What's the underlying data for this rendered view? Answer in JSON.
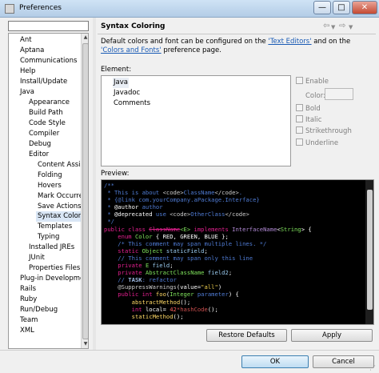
{
  "window": {
    "title": "Preferences",
    "minimize_glyph": "—",
    "maximize_glyph": "□",
    "close_glyph": "✕"
  },
  "filter": {
    "value": "",
    "placeholder": ""
  },
  "tree": {
    "items": [
      {
        "label": "Ant",
        "level": 0
      },
      {
        "label": "Aptana",
        "level": 0
      },
      {
        "label": "Communications",
        "level": 0
      },
      {
        "label": "Help",
        "level": 0
      },
      {
        "label": "Install/Update",
        "level": 0
      },
      {
        "label": "Java",
        "level": 0
      },
      {
        "label": "Appearance",
        "level": 1
      },
      {
        "label": "Build Path",
        "level": 1
      },
      {
        "label": "Code Style",
        "level": 1
      },
      {
        "label": "Compiler",
        "level": 1
      },
      {
        "label": "Debug",
        "level": 1
      },
      {
        "label": "Editor",
        "level": 1
      },
      {
        "label": "Content Assist",
        "level": 2
      },
      {
        "label": "Folding",
        "level": 2
      },
      {
        "label": "Hovers",
        "level": 2
      },
      {
        "label": "Mark Occurrences",
        "level": 2
      },
      {
        "label": "Save Actions",
        "level": 2
      },
      {
        "label": "Syntax Coloring",
        "level": 2,
        "selected": true
      },
      {
        "label": "Templates",
        "level": 2
      },
      {
        "label": "Typing",
        "level": 2
      },
      {
        "label": "Installed JREs",
        "level": 1
      },
      {
        "label": "JUnit",
        "level": 1
      },
      {
        "label": "Properties Files Editor",
        "level": 1
      },
      {
        "label": "Plug-in Development",
        "level": 0
      },
      {
        "label": "Rails",
        "level": 0
      },
      {
        "label": "Ruby",
        "level": 0
      },
      {
        "label": "Run/Debug",
        "level": 0
      },
      {
        "label": "Team",
        "level": 0
      },
      {
        "label": "XML",
        "level": 0
      }
    ]
  },
  "page": {
    "title": "Syntax Coloring",
    "description_before": "Default colors and font can be configured on the ",
    "link_text_editors": "'Text Editors'",
    "description_middle": " and on the ",
    "link_colors_fonts": "'Colors and Fonts'",
    "description_after": " preference page.",
    "element_label": "Element:",
    "elements": [
      "Java",
      "Javadoc",
      "Comments"
    ],
    "selected_element": "Java",
    "options": {
      "enable": "Enable",
      "color": "Color:",
      "bold": "Bold",
      "italic": "Italic",
      "strikethrough": "Strikethrough",
      "underline": "Underline"
    },
    "preview_label": "Preview:"
  },
  "nav": {
    "back": "⇦",
    "back_menu": "▼",
    "forward": "⇨",
    "forward_menu": "▼"
  },
  "preview_code": [
    [
      [
        "/**",
        "com"
      ]
    ],
    [
      [
        " * This is about ",
        "com"
      ],
      [
        "<code>",
        "tag"
      ],
      [
        "ClassName",
        "com"
      ],
      [
        "</code>",
        "tag"
      ],
      [
        ".",
        "com"
      ]
    ],
    [
      [
        " * {@link com.yourCompany.aPackage.Interface}",
        "com"
      ]
    ],
    [
      [
        " * ",
        "com"
      ],
      [
        "@author",
        "white"
      ],
      [
        " author",
        "com"
      ]
    ],
    [
      [
        " * ",
        "com"
      ],
      [
        "@deprecated",
        "white"
      ],
      [
        " use ",
        "com"
      ],
      [
        "<code>",
        "tag"
      ],
      [
        "OtherClass",
        "com"
      ],
      [
        "</code>",
        "tag"
      ]
    ],
    [
      [
        " */",
        "com"
      ]
    ],
    [
      [
        "public class ",
        "kw"
      ],
      [
        "ClassName",
        "strike"
      ],
      [
        "<E>",
        "type"
      ],
      [
        " implements ",
        "kw"
      ],
      [
        "InterfaceName",
        "purple"
      ],
      [
        "<",
        "white"
      ],
      [
        "String",
        "type"
      ],
      [
        "> {",
        "white"
      ]
    ],
    [
      [
        "    enum ",
        "kw"
      ],
      [
        "Color",
        "type"
      ],
      [
        " { RED, GREEN, BLUE };",
        "white"
      ]
    ],
    [
      [
        "    /* This comment may span multiple lines. */",
        "com"
      ]
    ],
    [
      [
        "    static ",
        "kw"
      ],
      [
        "Object",
        "type"
      ],
      [
        " staticField",
        "field"
      ],
      [
        ";",
        "white"
      ]
    ],
    [
      [
        "    // This comment may span only this line",
        "com"
      ]
    ],
    [
      [
        "    private ",
        "kw"
      ],
      [
        "E",
        "type"
      ],
      [
        " field",
        "field"
      ],
      [
        ";",
        "white"
      ]
    ],
    [
      [
        "    private ",
        "kw"
      ],
      [
        "AbstractClassName",
        "type"
      ],
      [
        " field2",
        "field"
      ],
      [
        ";",
        "white"
      ]
    ],
    [
      [
        "    // ",
        "com"
      ],
      [
        "TASK",
        "task"
      ],
      [
        ": refactor",
        "com"
      ]
    ],
    [
      [
        "    @SuppressWarnings",
        "ann"
      ],
      [
        "(",
        "white"
      ],
      [
        "value",
        "white"
      ],
      [
        "=",
        "white"
      ],
      [
        "\"all\"",
        "str"
      ],
      [
        ")",
        "white"
      ]
    ],
    [
      [
        "    public ",
        "kw"
      ],
      [
        "int ",
        "kw"
      ],
      [
        "foo",
        "meth"
      ],
      [
        "(",
        "white"
      ],
      [
        "Integer",
        "type"
      ],
      [
        " parameter",
        "com"
      ],
      [
        ") {",
        "white"
      ]
    ],
    [
      [
        "        abstractMethod",
        "meth"
      ],
      [
        "();",
        "white"
      ]
    ],
    [
      [
        "        int ",
        "kw"
      ],
      [
        "local",
        "white"
      ],
      [
        "= ",
        "white"
      ],
      [
        "42",
        "num"
      ],
      [
        "*hashCode",
        "dark"
      ],
      [
        "();",
        "white"
      ]
    ],
    [
      [
        "        staticMethod",
        "meth"
      ],
      [
        "();",
        "white"
      ]
    ]
  ],
  "buttons": {
    "restore_defaults": "Restore Defaults",
    "apply": "Apply",
    "ok": "OK",
    "cancel": "Cancel"
  }
}
